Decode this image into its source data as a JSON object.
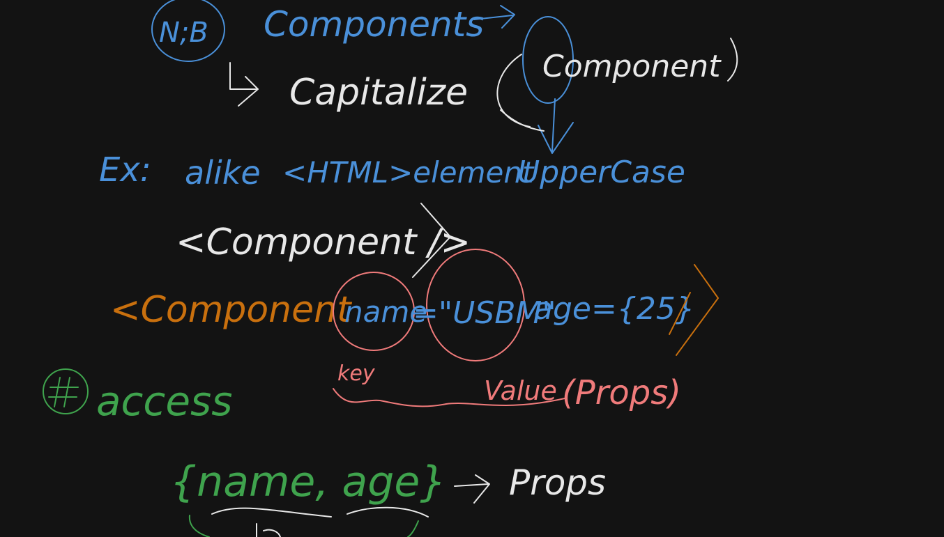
{
  "whiteboard": {
    "background": "#131313",
    "colors": {
      "blue": "#4a90d9",
      "white": "#e8e8e8",
      "orange": "#c9700e",
      "red": "#f07b7b",
      "green": "#3fa34d"
    },
    "notes": {
      "nb_label": "N;B",
      "components_text": "Components",
      "capitalize_text": "Capitalize",
      "component_paren_text": "Component",
      "example_label": "Ex:",
      "alike_text": "alike",
      "html_element_text": "<HTML>element",
      "uppercase_text": "UpperCase",
      "white_tag_text": "<Component />",
      "orange_tag_start": "<Component",
      "name_attr": "name",
      "usbm_value": "=\"USBM\"",
      "age_attr": "age={25}",
      "key_label": "key",
      "value_label": "Value",
      "props_paren_text": "(Props)",
      "access_label": "access",
      "destructure_text": "{name, age}",
      "arrow_props_text": "Props"
    }
  }
}
